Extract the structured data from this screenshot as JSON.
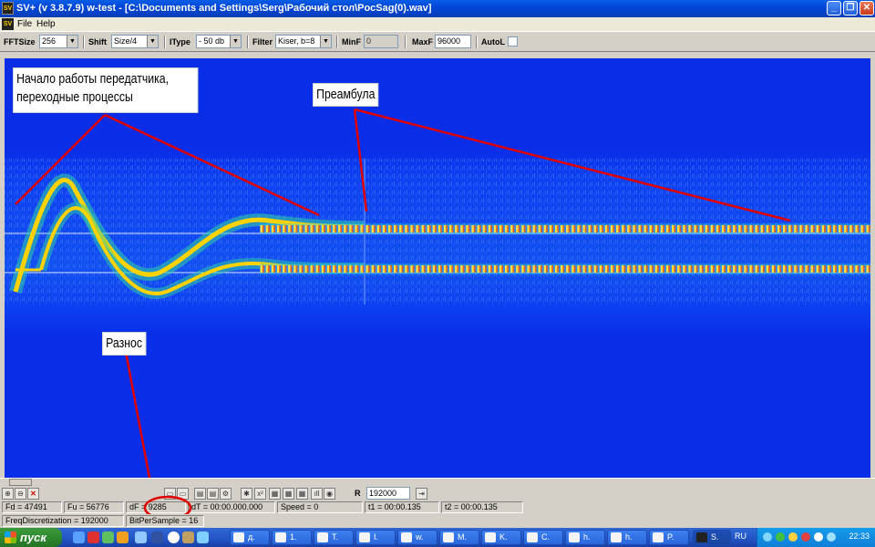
{
  "window": {
    "app_icon": "SV",
    "title": "SV+  (v 3.8.7.9) w-test  - [C:\\Documents and Settings\\Serg\\Рабочий стол\\PocSag(0).wav]",
    "min_label": "_",
    "restore_label": "❐",
    "close_label": "✕"
  },
  "menu": {
    "items": [
      "File",
      "Help"
    ]
  },
  "toolbar": {
    "fftsize_label": "FFTSize",
    "fftsize_value": "256",
    "shift_label": "Shift",
    "shift_value": "Size/4",
    "itype_label": "IType",
    "itype_value": "- 50 db",
    "filter_label": "Filter",
    "filter_value": "Kiser, b=8",
    "minf_label": "MinF",
    "minf_value": "0",
    "maxf_label": "MaxF",
    "maxf_value": "96000",
    "autol_label": "AutoL"
  },
  "annotations": {
    "start_line1": "Начало работы передатчика,",
    "start_line2": "переходные процессы",
    "preamble": "Преамбула",
    "spacing": "Разнос"
  },
  "tools": {
    "r_label": "R",
    "r_value": "192000"
  },
  "status": {
    "fd": "Fd = 47491",
    "fu": "Fu = 56776",
    "df": "dF = 9285",
    "dt": "dT = 00:00.000.000",
    "speed": "Speed = 0",
    "t1": "t1 = 00:00.135",
    "t2": "t2 = 00:00.135",
    "freqdisc": "FreqDiscretization = 192000",
    "bits": "BitPerSample = 16"
  },
  "taskbar": {
    "start_label": "пуск",
    "tasks": [
      "д.",
      "1.",
      "Т.",
      "I.",
      "w.",
      "M.",
      "K.",
      "С.",
      "h.",
      "h.",
      "P.",
      "S."
    ],
    "active_task": "S.",
    "lang": "RU",
    "clock": "22:33"
  },
  "colors": {
    "spectrogram_bg": "#0a2ee8",
    "signal_hot": "#ffd200",
    "signal_warm": "#2fd0a0",
    "annotation_line": "#e00000",
    "titlebar": "#0046d8"
  }
}
